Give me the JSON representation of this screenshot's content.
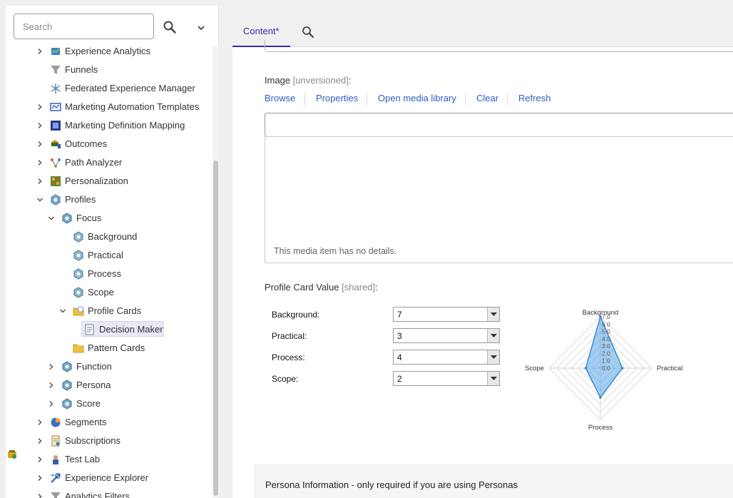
{
  "search": {
    "placeholder": "Search"
  },
  "tree": [
    {
      "label": "Experience Analytics",
      "icon": "experience-analytics-icon",
      "expandable": true,
      "expanded": false,
      "level": 0
    },
    {
      "label": "Funnels",
      "icon": "funnel-icon",
      "expandable": false,
      "level": 0
    },
    {
      "label": "Federated Experience Manager",
      "icon": "federated-icon",
      "expandable": false,
      "level": 0
    },
    {
      "label": "Marketing Automation Templates",
      "icon": "automation-icon",
      "expandable": true,
      "expanded": false,
      "level": 0
    },
    {
      "label": "Marketing Definition Mapping",
      "icon": "mapping-icon",
      "expandable": true,
      "expanded": false,
      "level": 0
    },
    {
      "label": "Outcomes",
      "icon": "outcomes-icon",
      "expandable": true,
      "expanded": false,
      "level": 0
    },
    {
      "label": "Path Analyzer",
      "icon": "path-analyzer-icon",
      "expandable": true,
      "expanded": false,
      "level": 0
    },
    {
      "label": "Personalization",
      "icon": "personalization-icon",
      "expandable": true,
      "expanded": false,
      "level": 0
    },
    {
      "label": "Profiles",
      "icon": "profile-icon",
      "expandable": true,
      "expanded": true,
      "level": 0
    },
    {
      "label": "Focus",
      "icon": "profile-icon",
      "expandable": true,
      "expanded": true,
      "level": 1
    },
    {
      "label": "Background",
      "icon": "profile-key-icon",
      "expandable": false,
      "level": 2
    },
    {
      "label": "Practical",
      "icon": "profile-key-icon",
      "expandable": false,
      "level": 2
    },
    {
      "label": "Process",
      "icon": "profile-key-icon",
      "expandable": false,
      "level": 2
    },
    {
      "label": "Scope",
      "icon": "profile-key-icon",
      "expandable": false,
      "level": 2
    },
    {
      "label": "Profile Cards",
      "icon": "profile-cards-folder-icon",
      "expandable": true,
      "expanded": true,
      "level": 2
    },
    {
      "label": "Decision Maker",
      "icon": "profile-card-icon",
      "expandable": false,
      "level": 3,
      "selected": true
    },
    {
      "label": "Pattern Cards",
      "icon": "folder-icon",
      "expandable": false,
      "level": 2
    },
    {
      "label": "Function",
      "icon": "profile-icon",
      "expandable": true,
      "expanded": false,
      "level": 1
    },
    {
      "label": "Persona",
      "icon": "profile-icon",
      "expandable": true,
      "expanded": false,
      "level": 1
    },
    {
      "label": "Score",
      "icon": "profile-icon",
      "expandable": true,
      "expanded": false,
      "level": 1
    },
    {
      "label": "Segments",
      "icon": "segments-icon",
      "expandable": true,
      "expanded": false,
      "level": 0
    },
    {
      "label": "Subscriptions",
      "icon": "subscriptions-icon",
      "expandable": true,
      "expanded": false,
      "level": 0
    },
    {
      "label": "Test Lab",
      "icon": "test-lab-icon",
      "expandable": true,
      "expanded": false,
      "level": 0
    },
    {
      "label": "Experience Explorer",
      "icon": "experience-explorer-icon",
      "expandable": true,
      "expanded": false,
      "level": 0
    },
    {
      "label": "Analytics Filters",
      "icon": "funnel-icon",
      "expandable": true,
      "expanded": false,
      "level": 0
    }
  ],
  "tabs": {
    "content_label": "Content*"
  },
  "image_field": {
    "title": "Image",
    "meta": "[unversioned]",
    "colon": ":",
    "actions": [
      "Browse",
      "Properties",
      "Open media library",
      "Clear",
      "Refresh"
    ],
    "details_text": "This media item has no details."
  },
  "profile_card": {
    "title": "Profile Card Value",
    "meta": "[shared]",
    "colon": ":",
    "rows": [
      {
        "label": "Background:",
        "value": "7"
      },
      {
        "label": "Practical:",
        "value": "3"
      },
      {
        "label": "Process:",
        "value": "4"
      },
      {
        "label": "Scope:",
        "value": "2"
      }
    ]
  },
  "chart_data": {
    "type": "radar",
    "axes": [
      "Background",
      "Practical",
      "Process",
      "Scope"
    ],
    "values": [
      7,
      3,
      4,
      2
    ],
    "scale_max": 7,
    "tick_labels": [
      "0.0",
      "1.0",
      "2.0",
      "3.0",
      "4.0",
      "5.0",
      "6.0",
      "7.0"
    ],
    "fill_color": "#5aa6e6"
  },
  "persona_section": {
    "title": "Persona Information - only required if you are using Personas"
  },
  "colors": {
    "accent": "#3b2aa8",
    "link": "#2d5fbf"
  }
}
